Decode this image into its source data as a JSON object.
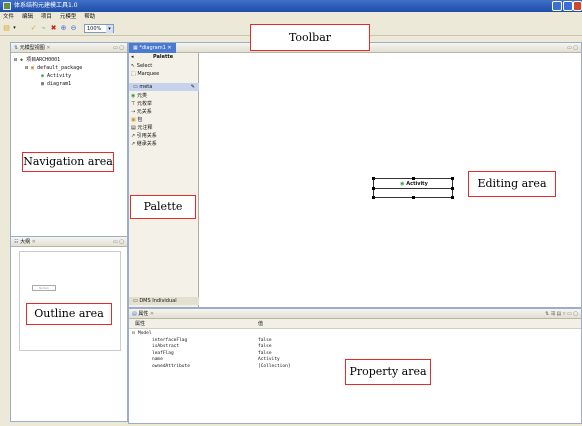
{
  "app": {
    "title": "体系结构元建模工具1.0"
  },
  "menu": [
    "文件",
    "编辑",
    "项目",
    "元模型",
    "帮助"
  ],
  "toolbar": {
    "zoom_value": "100%"
  },
  "navigation": {
    "tab_label": "元模型视图",
    "tree": [
      {
        "label": "项目ARCH0001",
        "level": 0,
        "icon": "project-icon",
        "expander": "⊟"
      },
      {
        "label": "default_package",
        "level": 1,
        "icon": "package-icon",
        "expander": "⊟"
      },
      {
        "label": "Activity",
        "level": 2,
        "icon": "class-icon",
        "expander": ""
      },
      {
        "label": "diagram1",
        "level": 2,
        "icon": "diagram-icon",
        "expander": ""
      }
    ]
  },
  "outline": {
    "tab_label": "大纲",
    "thumb_label": "Node1"
  },
  "editor": {
    "tab_label": "*diagram1",
    "palette": {
      "title": "Palette",
      "tools": [
        "Select",
        "Marquee"
      ],
      "section": "meta",
      "items": [
        "元类",
        "元枚举",
        "元关系",
        "包",
        "元注释",
        "引用关系",
        "继承关系"
      ],
      "footer": "DMS Individual"
    },
    "node_label": "Activity"
  },
  "properties": {
    "tab_label": "属性",
    "col_property": "属性",
    "col_value": "值",
    "group": "Model",
    "rows": [
      {
        "key": "interfaceFlag",
        "value": "false"
      },
      {
        "key": "isAbstract",
        "value": "false"
      },
      {
        "key": "leafFlag",
        "value": "false"
      },
      {
        "key": "name",
        "value": "Activity"
      },
      {
        "key": "ownedAttribute",
        "value": "[Collection]"
      }
    ]
  },
  "annotations": {
    "toolbar": "Toolbar",
    "navigation": "Navigation area",
    "palette": "Palette",
    "editing": "Editing area",
    "outline": "Outline area",
    "property": "Property area"
  },
  "colors": {
    "title_bar": "#1f4ea8",
    "active_tab": "#4a7bd0",
    "annotation_border": "#e32c2c",
    "chrome": "#ece9d8"
  }
}
